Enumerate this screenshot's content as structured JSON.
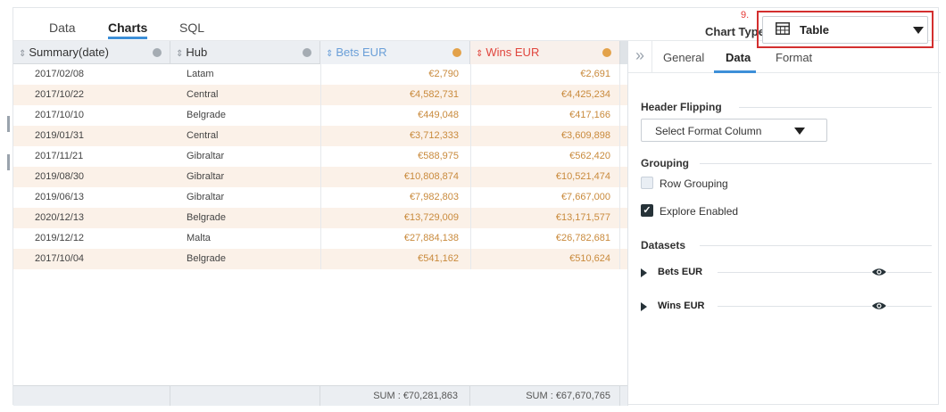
{
  "tabs": [
    {
      "label": "Data"
    },
    {
      "label": "Charts"
    },
    {
      "label": "SQL"
    }
  ],
  "chart_type": {
    "label": "Chart Type:",
    "step_number": "9.",
    "value": "Table",
    "icon": "table-grid-icon"
  },
  "table": {
    "columns": [
      {
        "label": "Summary(date)"
      },
      {
        "label": "Hub"
      },
      {
        "label": "Bets EUR"
      },
      {
        "label": "Wins EUR"
      }
    ],
    "rows": [
      {
        "date": "2017/02/08",
        "hub": "Latam",
        "bets": "€2,790",
        "wins": "€2,691"
      },
      {
        "date": "2017/10/22",
        "hub": "Central",
        "bets": "€4,582,731",
        "wins": "€4,425,234"
      },
      {
        "date": "2017/10/10",
        "hub": "Belgrade",
        "bets": "€449,048",
        "wins": "€417,166"
      },
      {
        "date": "2019/01/31",
        "hub": "Central",
        "bets": "€3,712,333",
        "wins": "€3,609,898"
      },
      {
        "date": "2017/11/21",
        "hub": "Gibraltar",
        "bets": "€588,975",
        "wins": "€562,420"
      },
      {
        "date": "2019/08/30",
        "hub": "Gibraltar",
        "bets": "€10,808,874",
        "wins": "€10,521,474"
      },
      {
        "date": "2019/06/13",
        "hub": "Gibraltar",
        "bets": "€7,982,803",
        "wins": "€7,667,000"
      },
      {
        "date": "2020/12/13",
        "hub": "Belgrade",
        "bets": "€13,729,009",
        "wins": "€13,171,577"
      },
      {
        "date": "2019/12/12",
        "hub": "Malta",
        "bets": "€27,884,138",
        "wins": "€26,782,681"
      },
      {
        "date": "2017/10/04",
        "hub": "Belgrade",
        "bets": "€541,162",
        "wins": "€510,624"
      }
    ],
    "footer": {
      "bets_sum": "SUM : €70,281,863",
      "wins_sum": "SUM : €67,670,765"
    }
  },
  "panel": {
    "collapse_icon": "double-chevron-right-icon",
    "tabs": [
      {
        "label": "General"
      },
      {
        "label": "Data"
      },
      {
        "label": "Format"
      }
    ],
    "header_flipping": {
      "title": "Header Flipping",
      "select_label": "Select Format Column"
    },
    "grouping": {
      "title": "Grouping",
      "row_grouping": {
        "label": "Row Grouping",
        "checked": false
      },
      "explore_enabled": {
        "label": "Explore Enabled",
        "checked": true
      }
    },
    "datasets": {
      "title": "Datasets",
      "items": [
        {
          "label": "Bets EUR",
          "visible": true
        },
        {
          "label": "Wins EUR",
          "visible": true
        }
      ]
    }
  },
  "colors": {
    "accent": "#3d8fd8",
    "bets": "#6a9fd8",
    "wins": "#e0463e",
    "value_text": "#c98a3c",
    "alt_row": "#fbf1e8",
    "highlight": "#d32f2f"
  }
}
